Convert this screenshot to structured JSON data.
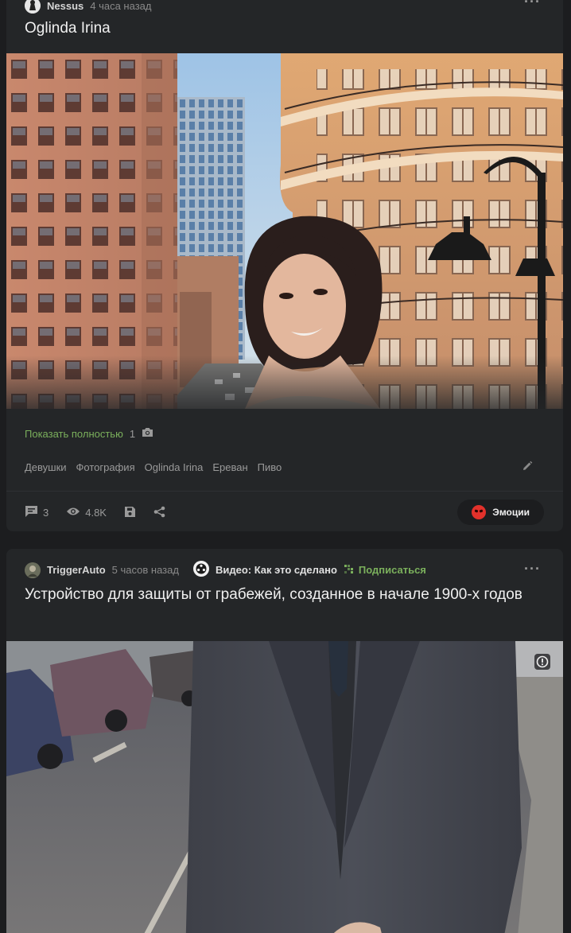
{
  "post1": {
    "author": "Nessus",
    "time": "4 часа назад",
    "title": "Oglinda Irina",
    "show_full": "Показать полностью",
    "photo_count": "1",
    "tags": [
      "Девушки",
      "Фотография",
      "Oglinda Irina",
      "Ереван",
      "Пиво"
    ],
    "comments": "3",
    "views": "4.8K",
    "emotions_label": "Эмоции"
  },
  "post2": {
    "author": "TriggerAuto",
    "time": "5 часов назад",
    "community": "Видео: Как это сделано",
    "subscribe": "Подписаться",
    "title": "Устройство для защиты от грабежей, созданное в начале 1900-х годов"
  },
  "colors": {
    "accent_green": "#7bb05c",
    "card_bg": "#242628",
    "page_bg": "#1c1d1f"
  }
}
